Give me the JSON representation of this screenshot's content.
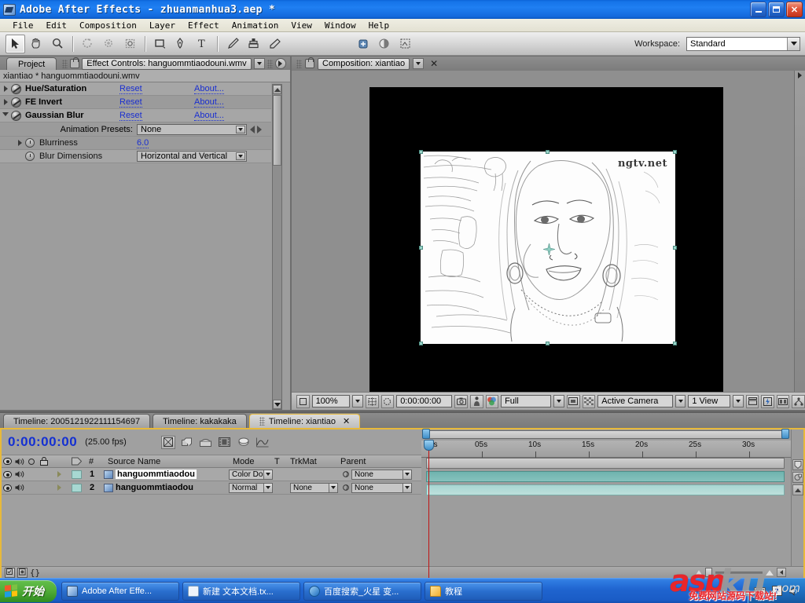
{
  "window": {
    "title": "Adobe After Effects - zhuanmanhua3.aep *",
    "buttons": {
      "minimize": "_",
      "maximize": "❐",
      "close": "✕"
    }
  },
  "menubar": {
    "items": [
      "File",
      "Edit",
      "Composition",
      "Layer",
      "Effect",
      "Animation",
      "View",
      "Window",
      "Help"
    ]
  },
  "toolbar": {
    "tools": [
      {
        "name": "selection-tool",
        "selected": true
      },
      {
        "name": "hand-tool",
        "selected": false
      },
      {
        "name": "zoom-tool",
        "selected": false
      },
      {
        "name": "rotation-tool",
        "selected": false
      },
      {
        "name": "camera-orbit-tool",
        "selected": false
      },
      {
        "name": "pan-behind-tool",
        "selected": false
      },
      {
        "name": "rectangle-mask-tool",
        "selected": false
      },
      {
        "name": "pen-tool",
        "selected": false
      },
      {
        "name": "type-tool",
        "selected": false
      },
      {
        "name": "brush-tool",
        "selected": false
      },
      {
        "name": "clone-stamp-tool",
        "selected": false
      },
      {
        "name": "eraser-tool",
        "selected": false
      }
    ],
    "workspace_label": "Workspace:",
    "workspace_value": "Standard"
  },
  "effect_controls": {
    "project_tab": "Project",
    "tab_title": "Effect Controls: hanguommtiaodouni.wmv",
    "header": "xiantiao * hanguommtiaodouni.wmv",
    "effects": [
      {
        "name": "Hue/Saturation",
        "reset": "Reset",
        "about": "About...",
        "expanded": false
      },
      {
        "name": "FE Invert",
        "reset": "Reset",
        "about": "About...",
        "expanded": false
      },
      {
        "name": "Gaussian Blur",
        "reset": "Reset",
        "about": "About...",
        "expanded": true
      }
    ],
    "animation_presets_label": "Animation Presets:",
    "animation_presets_value": "None",
    "properties": [
      {
        "label": "Blurriness",
        "value": "6.0",
        "type": "number"
      },
      {
        "label": "Blur Dimensions",
        "value": "Horizontal and Vertical",
        "type": "select"
      }
    ]
  },
  "composition": {
    "tab_title": "Composition: xiantiao",
    "close_label": "✕",
    "watermark": "ngtv.net",
    "footer": {
      "magnification": "100%",
      "time": "0:00:00:00",
      "resolution": "Full",
      "camera": "Active Camera",
      "views": "1 View"
    }
  },
  "timeline": {
    "tabs": [
      {
        "label": "Timeline: 2005121922111154697",
        "active": false
      },
      {
        "label": "Timeline: kakakaka",
        "active": false
      },
      {
        "label": "Timeline: xiantiao",
        "active": true,
        "close": "✕"
      }
    ],
    "current_time": "0:00:00:00",
    "fps": "(25.00 fps)",
    "columns": [
      "#",
      "Source Name",
      "Mode",
      "T",
      "TrkMat",
      "Parent"
    ],
    "layers": [
      {
        "index": "1",
        "source_name": "hanguommtiaodou",
        "mode": "Color Do",
        "trkmat": "",
        "parent": "None",
        "selected": true
      },
      {
        "index": "2",
        "source_name": "hanguommtiaodou",
        "mode": "Normal",
        "trkmat": "None",
        "parent": "None",
        "selected": false
      }
    ],
    "ruler_labels": [
      "0s",
      "05s",
      "10s",
      "15s",
      "20s",
      "25s",
      "30s"
    ]
  },
  "taskbar": {
    "start": "开始",
    "items": [
      {
        "label": "Adobe After Effe...",
        "icon_color": "#bcd6f0"
      },
      {
        "label": "新建 文本文档.tx...",
        "icon_color": "#e8f0fa"
      },
      {
        "label": "百度搜索_火星 变...",
        "icon_color": "#2f8ad8"
      },
      {
        "label": "教程",
        "icon_color": "#ffd060"
      }
    ],
    "tray": [
      "keyboard-icon",
      "help-icon",
      "volume-icon"
    ]
  },
  "watermark": {
    "asp": "asp",
    "ku": "ku",
    "com": ".com",
    "tagline": "免费网站源码下载站!"
  },
  "colors": {
    "accent_blue": "#1f7ff2",
    "panel_gray": "#9d9d9d",
    "tab_yellow": "#e8b93a",
    "link_blue": "#1a2fd0",
    "time_blue": "#1430d2",
    "track_teal": "#6fb3ae",
    "watermark_red": "#e8262b"
  }
}
